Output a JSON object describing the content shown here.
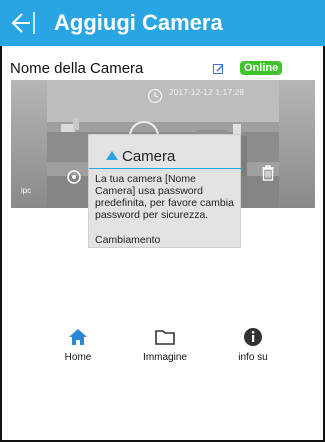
{
  "header": {
    "title": "Aggiugi Camera",
    "back_icon": "back-arrow-icon",
    "color": "#29a5e4"
  },
  "camera": {
    "name": "Nome della Camera",
    "status": "Online",
    "status_color": "#3ec32a",
    "timestamp": "2017-12-12  1:17:28",
    "source_label": "ipc"
  },
  "tooltip": {
    "title": "Camera",
    "message": "La tua camera [Nome Camera] usa password predefinita, per favore cambia password per sicurezza.",
    "action": "Cambiamento"
  },
  "nav": {
    "items": [
      {
        "label": "Home",
        "icon": "home-icon"
      },
      {
        "label": "Immagine",
        "icon": "folder-icon"
      },
      {
        "label": "info su",
        "icon": "info-icon"
      }
    ]
  }
}
